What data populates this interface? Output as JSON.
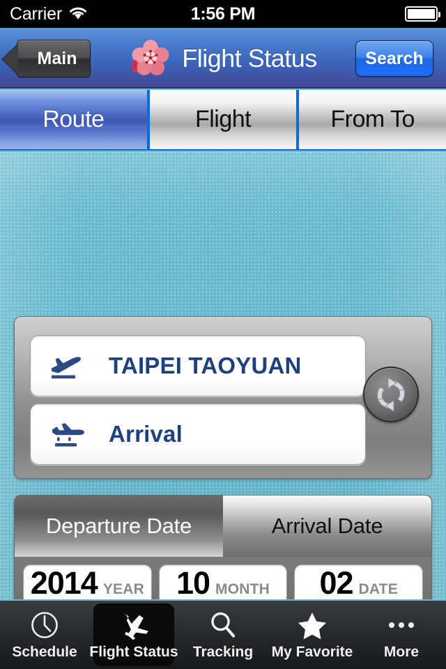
{
  "status_bar": {
    "carrier": "Carrier",
    "wifi_icon": "wifi-icon",
    "time": "1:56 PM",
    "battery_icon": "battery-full-icon"
  },
  "nav_bar": {
    "back_label": "Main",
    "logo_icon": "plum-blossom-logo",
    "title": "Flight Status",
    "search_label": "Search"
  },
  "segmented_tabs": {
    "selected": "Route",
    "items": [
      {
        "label": "Route",
        "selected": true
      },
      {
        "label": "Flight",
        "selected": false
      },
      {
        "label": "From To",
        "selected": false
      }
    ]
  },
  "route_panel": {
    "departure": {
      "icon": "plane-takeoff-icon",
      "value": "TAIPEI TAOYUAN"
    },
    "arrival": {
      "icon": "plane-landing-icon",
      "value": "Arrival"
    },
    "swap_icon": "swap-refresh-icon"
  },
  "date_panel": {
    "tabs": [
      {
        "label": "Departure Date",
        "selected": true
      },
      {
        "label": "Arrival Date",
        "selected": false
      }
    ],
    "year": {
      "value": "2014",
      "unit": "YEAR"
    },
    "month": {
      "value": "10",
      "unit": "MONTH"
    },
    "day": {
      "value": "02",
      "unit": "DATE"
    }
  },
  "tab_bar": {
    "items": [
      {
        "label": "Schedule",
        "icon": "clock-icon",
        "selected": false
      },
      {
        "label": "Flight Status",
        "icon": "airplane-icon",
        "selected": true
      },
      {
        "label": "Tracking",
        "icon": "magnifier-icon",
        "selected": false
      },
      {
        "label": "My Favorite",
        "icon": "star-icon",
        "selected": false
      },
      {
        "label": "More",
        "icon": "ellipsis-icon",
        "selected": false
      }
    ]
  },
  "colors": {
    "accent_blue": "#0a6be0",
    "nav_blue": "#3c65bb",
    "background_cyan": "#64b8ce",
    "field_text_navy": "#1f3f7f",
    "logo_pink": "#e8808f"
  }
}
